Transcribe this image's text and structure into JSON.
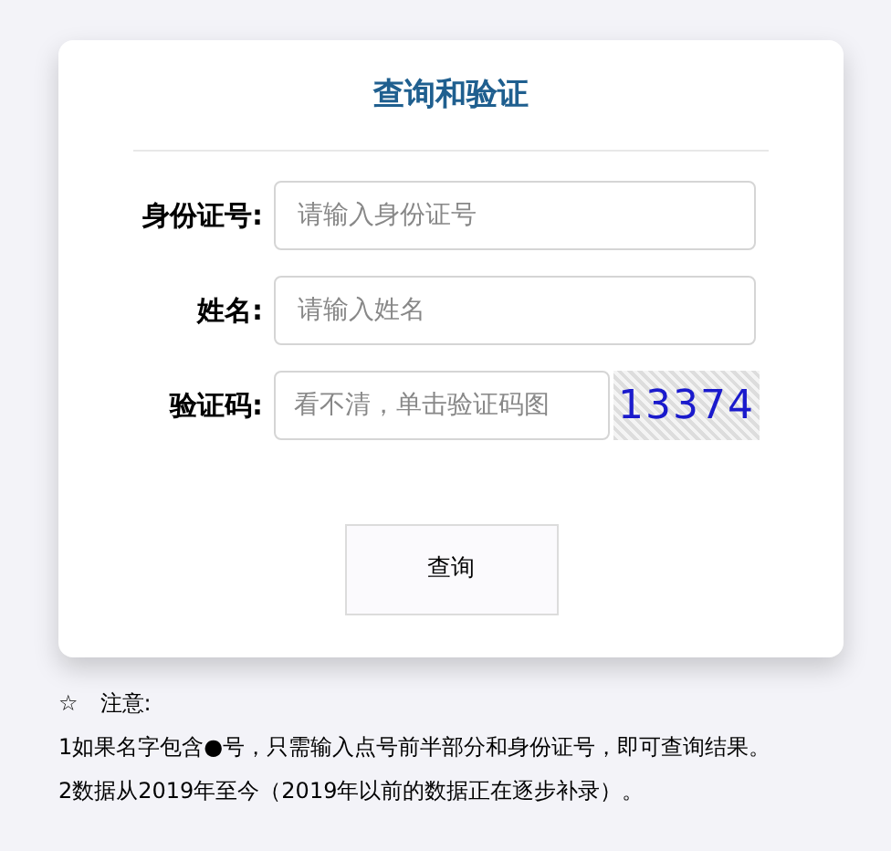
{
  "title": "查询和验证",
  "fields": [
    {
      "kind": "text",
      "label": "身份证号:",
      "placeholder": "请输入身份证号"
    },
    {
      "kind": "text",
      "label": "姓名:",
      "placeholder": "请输入姓名"
    },
    {
      "kind": "captcha",
      "label": "验证码:",
      "placeholder": "看不清，单击验证码图",
      "captcha": "13374"
    }
  ],
  "button": "查询",
  "notice": {
    "star": "☆",
    "title": "注意:",
    "lines": [
      "1如果名字包含●号，只需输入点号前半部分和身份证号，即可查询结果。",
      "2数据从2019年至今（2019年以前的数据正在逐步补录）。"
    ]
  }
}
